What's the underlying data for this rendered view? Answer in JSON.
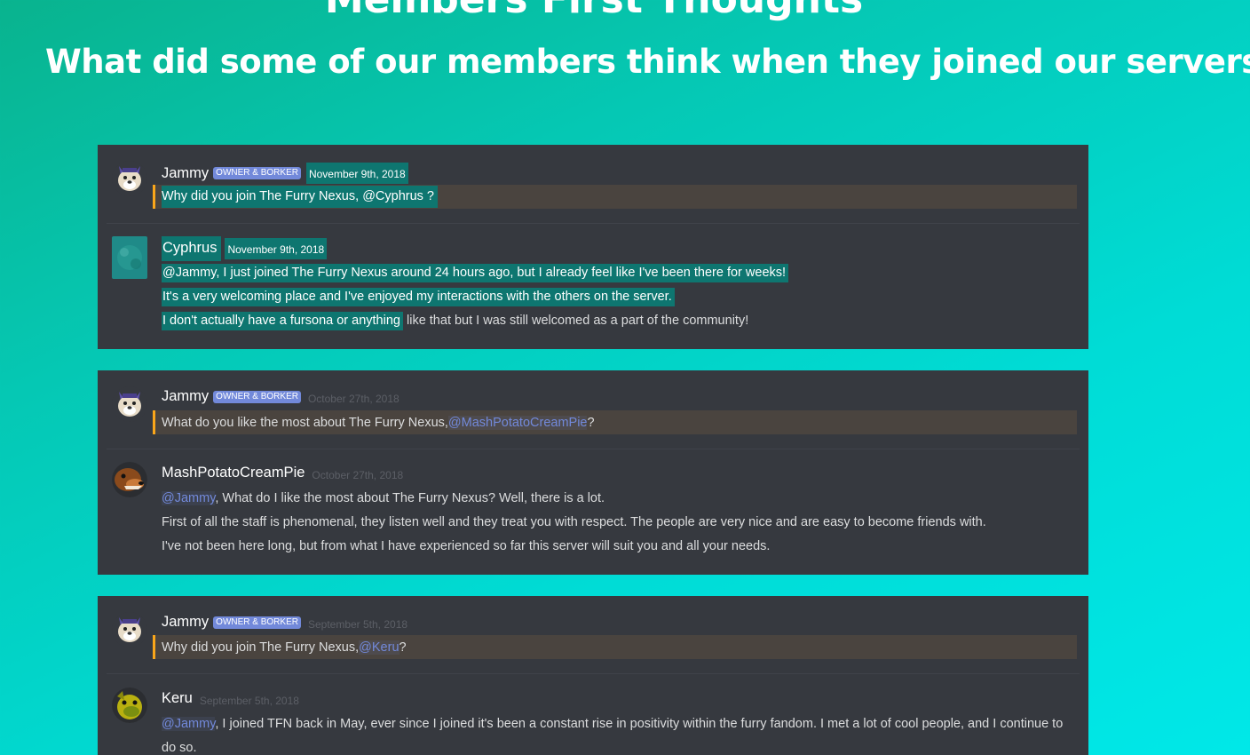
{
  "header": {
    "title": "Members First Thoughts",
    "subtitle": "What did some of our members think when they joined our servers?"
  },
  "colors": {
    "accent": "#7289da",
    "card_bg": "#36393f",
    "quote_bar": "#faa61a",
    "selection": "#0e7670"
  },
  "badge_label": "OWNER & BORKER",
  "cards": [
    {
      "question": {
        "username": "Jammy",
        "timestamp": "November 9th, 2018",
        "text_before": "Why did you join The Furry Nexus, ",
        "mention": "@Cyphrus",
        "text_after": " ?"
      },
      "answer": {
        "username": "Cyphrus",
        "timestamp": "November 9th, 2018",
        "mention": "@Jammy",
        "line1_rest": ", I just joined The Furry Nexus around 24 hours ago, but I already feel like I've been there for weeks!",
        "line2": "It's a very welcoming place and I've enjoyed my interactions with the others on the server.",
        "line3_a": "I don't actually have a fursona or anything",
        "line3_b": " like that but I was still welcomed as a part of the community!"
      }
    },
    {
      "question": {
        "username": "Jammy",
        "timestamp": "October 27th, 2018",
        "text_before": "What do you like the most about The Furry Nexus, ",
        "mention": "@MashPotatoCreamPie",
        "text_after": " ?"
      },
      "answer": {
        "username": "MashPotatoCreamPie",
        "timestamp": "October 27th, 2018",
        "mention": "@Jammy",
        "line1_rest": ", What do I like the most about The Furry Nexus? Well, there is a lot.",
        "line2": "First of all the staff is phenomenal, they listen well and they treat you with respect. The people are very nice and are easy to become friends with.",
        "line3": "I've not been here long, but from what I have experienced so far this server will suit you and all your needs."
      }
    },
    {
      "question": {
        "username": "Jammy",
        "timestamp": "September 5th, 2018",
        "text_before": "Why did you join The Furry Nexus, ",
        "mention": "@Keru",
        "text_after": " ?"
      },
      "answer": {
        "username": "Keru",
        "timestamp": "September 5th, 2018",
        "mention": "@Jammy",
        "line1_rest": ", I joined TFN back in May, ever since I joined it's been a constant rise in positivity within the furry fandom. I met a lot of cool people, and I continue to",
        "line2": "do so."
      }
    }
  ]
}
